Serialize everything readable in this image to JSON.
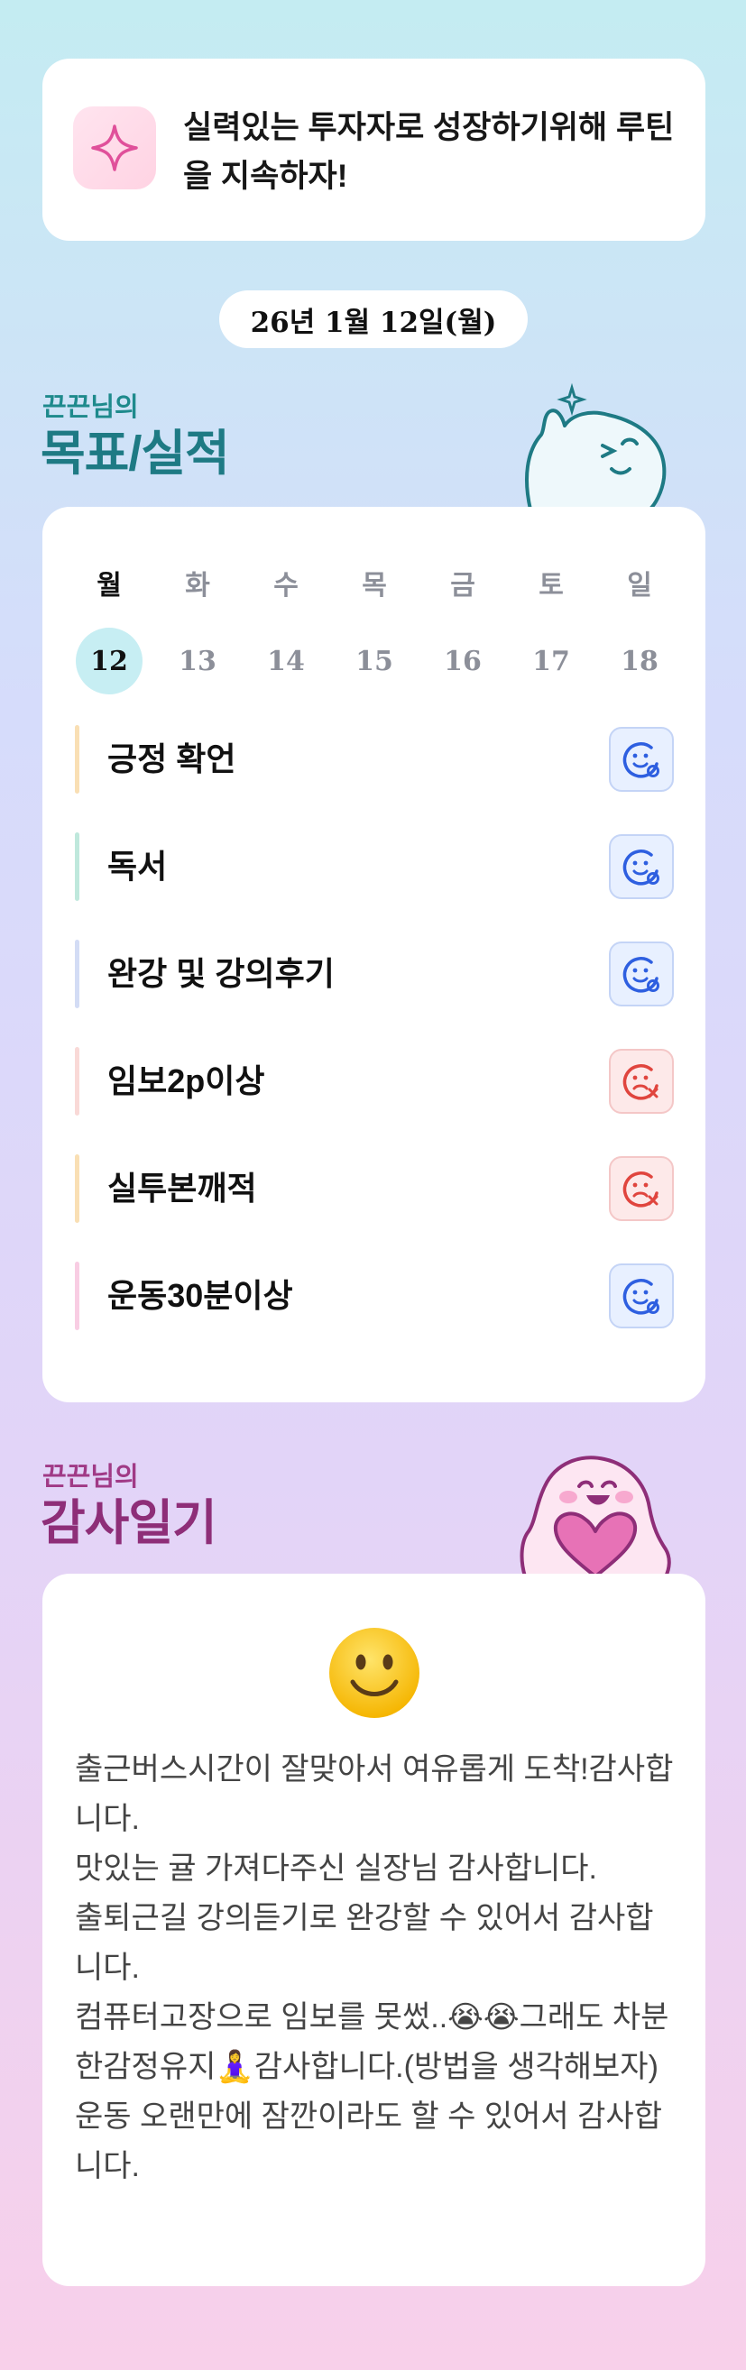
{
  "motto": {
    "text": "실력있는 투자자로 성장하기위해 루틴을 지속하자!",
    "icon": "sparkle-icon"
  },
  "date": "26년 1월 12일(월)",
  "goals_section": {
    "subtitle": "끈끈님의",
    "title": "목표/실적",
    "mascot": "waving-ghost-mascot"
  },
  "week": [
    {
      "label": "월",
      "day": "12",
      "active": true
    },
    {
      "label": "화",
      "day": "13",
      "active": false
    },
    {
      "label": "수",
      "day": "14",
      "active": false
    },
    {
      "label": "목",
      "day": "15",
      "active": false
    },
    {
      "label": "금",
      "day": "16",
      "active": false
    },
    {
      "label": "토",
      "day": "17",
      "active": false
    },
    {
      "label": "일",
      "day": "18",
      "active": false
    }
  ],
  "goals": [
    {
      "label": "긍정 확언",
      "status": "done",
      "color": "#f9dfb4"
    },
    {
      "label": "독서",
      "status": "done",
      "color": "#bfe8dc"
    },
    {
      "label": "완강 및 강의후기",
      "status": "done",
      "color": "#d3dcf5"
    },
    {
      "label": "임보2p이상",
      "status": "failed",
      "color": "#f9d9d7"
    },
    {
      "label": "실투본깨적",
      "status": "failed",
      "color": "#f9dfb4"
    },
    {
      "label": "운동30분이상",
      "status": "done",
      "color": "#f8cde3"
    }
  ],
  "colors": {
    "done": "#2e5fe0",
    "failed": "#e0453e"
  },
  "gratitude_section": {
    "subtitle": "끈끈님의",
    "title": "감사일기",
    "mascot": "heart-ghost-mascot"
  },
  "diary": {
    "emoji": "🙂",
    "text": "출근버스시간이 잘맞아서 여유롭게 도착!감사합니다.\n맛있는 귤 가져다주신 실장님 감사합니다.\n출퇴근길 강의듣기로 완강할 수 있어서 감사합니다.\n컴퓨터고장으로 임보를 못썼..😭😭그래도 차분한감정유지🧘‍♀️감사합니다.(방법을 생각해보자)\n운동 오랜만에 잠깐이라도 할 수 있어서 감사합니다."
  }
}
